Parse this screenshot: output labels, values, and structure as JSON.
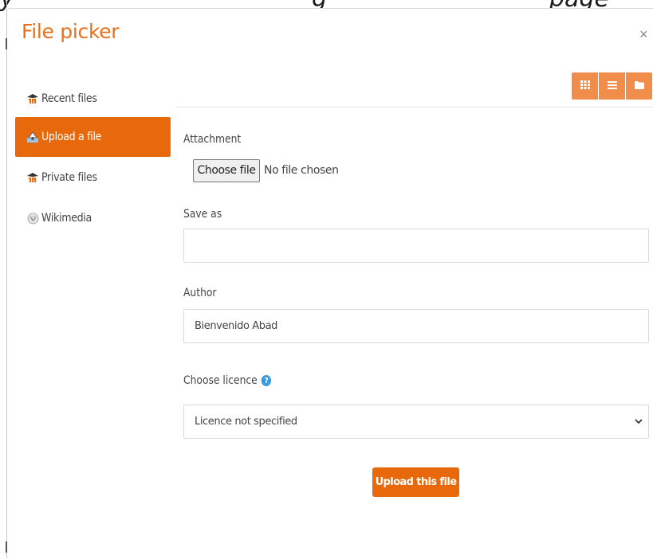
{
  "background_text": {
    "left": "y",
    "middle": "g",
    "right": "page"
  },
  "dialog": {
    "title": "File picker",
    "close_label": "×"
  },
  "sidebar": {
    "items": [
      {
        "label": "Recent files",
        "icon": "moodle-icon",
        "active": false
      },
      {
        "label": "Upload a file",
        "icon": "upload-icon",
        "active": true
      },
      {
        "label": "Private files",
        "icon": "moodle-icon",
        "active": false
      },
      {
        "label": "Wikimedia",
        "icon": "wikimedia-icon",
        "active": false
      }
    ]
  },
  "toolbar": {
    "buttons": [
      "grid-view-icon",
      "list-view-icon",
      "folder-view-icon"
    ]
  },
  "form": {
    "attachment_label": "Attachment",
    "choose_file_label": "Choose file",
    "no_file_text": "No file chosen",
    "save_as_label": "Save as",
    "save_as_value": "",
    "author_label": "Author",
    "author_value": "Bienvenido Abad",
    "licence_label": "Choose licence",
    "licence_selected": "Licence not specified",
    "upload_button": "Upload this file"
  },
  "colors": {
    "accent": "#e8690b",
    "toolbar": "#f18d4b",
    "help": "#3a9ad9"
  }
}
